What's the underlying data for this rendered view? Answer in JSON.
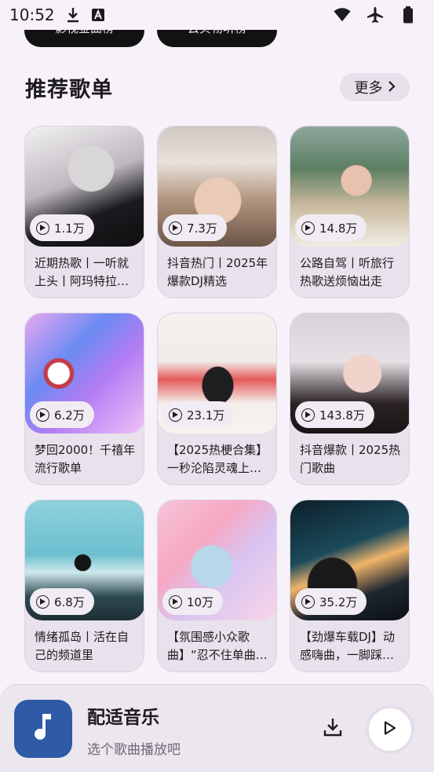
{
  "status_bar": {
    "time": "10:52"
  },
  "top_pills": [
    {
      "label": "影视金曲榜"
    },
    {
      "label": "云贝物听榜"
    }
  ],
  "section": {
    "title": "推荐歌单",
    "more_label": "更多"
  },
  "playlists": [
    {
      "plays": "1.1万",
      "title": "近期热歌丨一听就上头丨阿玛特拉…"
    },
    {
      "plays": "7.3万",
      "title": "抖音热门丨2025年爆款DJ精选"
    },
    {
      "plays": "14.8万",
      "title": "公路自驾丨听旅行热歌送烦恼出走"
    },
    {
      "plays": "6.2万",
      "title": "梦回2000！千禧年流行歌单"
    },
    {
      "plays": "23.1万",
      "title": "【2025热梗合集】一秒沦陷灵魂上…"
    },
    {
      "plays": "143.8万",
      "title": "抖音爆款丨2025热门歌曲"
    },
    {
      "plays": "6.8万",
      "title": "情绪孤岛丨活在自己的频道里"
    },
    {
      "plays": "10万",
      "title": "【氛围感小众歌曲】“忍不住单曲…"
    },
    {
      "plays": "35.2万",
      "title": "【劲爆车载DJ】动感嗨曲，一脚踩…"
    }
  ],
  "player": {
    "name": "配适音乐",
    "subtitle": "选个歌曲播放吧"
  },
  "colors": {
    "background": "#f7f2f9",
    "card": "#e9e1ec",
    "album_tile": "#2e5aa6"
  }
}
